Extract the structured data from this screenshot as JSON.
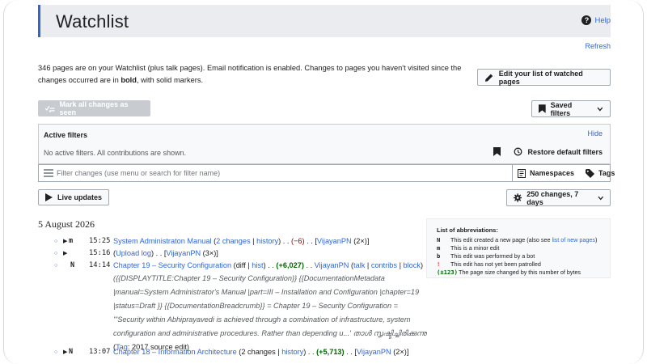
{
  "page": {
    "title": "Watchlist",
    "help_label": "Help",
    "refresh_label": "Refresh"
  },
  "intro": {
    "part1": "346 pages are on your Watchlist (plus talk pages). Email notification is enabled. Changes to pages you haven't visited since the changes occurred are in ",
    "bold": "bold",
    "part2": ", with solid markers."
  },
  "buttons": {
    "edit_watchlist": "Edit your list of watched pages",
    "mark_all_seen": "Mark all changes as seen",
    "saved_filters": "Saved filters",
    "live_updates": "Live updates",
    "range": "250 changes, 7 days"
  },
  "filters": {
    "title": "Active filters",
    "hide": "Hide",
    "none_text": "No active filters. All contributions are shown.",
    "restore": "Restore default filters",
    "search_placeholder": "Filter changes (use menu or search for filter name)",
    "namespaces": "Namespaces",
    "tags": "Tags"
  },
  "date_heading": "5 August 2026",
  "abbreviations": {
    "title": "List of abbreviations:",
    "items": [
      {
        "key": "N",
        "text": "This edit created a new page (also see ",
        "link": "list of new pages",
        "tail": ")"
      },
      {
        "key": "m",
        "text": "This is a minor edit"
      },
      {
        "key": "b",
        "text": "This edit was performed by a bot"
      },
      {
        "key": "!",
        "text": "This edit has not yet been patrolled"
      },
      {
        "key": "(±123)",
        "text": "The page size changed by this number of bytes"
      }
    ]
  },
  "changes": [
    {
      "flag": "m",
      "time": "15:25",
      "page": "System Administraton Manual",
      "changes": "2 changes",
      "history": "history",
      "size": "(−6)",
      "user": "VijayanPN",
      "count": "(2×)"
    },
    {
      "flag": "",
      "time": "15:16",
      "page": "Upload log",
      "user": "VijayanPN",
      "count": "(3×)"
    },
    {
      "flag": "N",
      "time": "14:14",
      "page": "Chapter 19 – Security Configuration",
      "diff": "diff",
      "hist": "hist",
      "size": "(+6,027)",
      "user": "VijayanPN",
      "talk": "talk",
      "contribs": "contribs",
      "block": "block",
      "summary": "{{DISPLAYTITLE:Chapter 19 – Security Configuration}} {{DocumentationMetadata |manual=System Administrator's Manual |part=III – Installation and Configuration |chapter=19 |status=Draft }} {{DocumentationBreadcrumb}} = Chapter 19 – Security Configuration = '''Security within Abhiprayavedi is achieved through a combination of infrastructure, system configuration and administrative procedures. Rather than depending u...' താൾ സൃഷ്ടിച്ചിരിക്കുന്നു",
      "tag_label": "Tag",
      "tag": "2017 source edit"
    },
    {
      "flag": "N",
      "time": "13:07",
      "page": "Chapter 18 – Information Architecture",
      "changes": "2 changes",
      "history": "history",
      "size": "(+5,713)",
      "user": "VijayanPN",
      "count": "(2×)"
    }
  ]
}
